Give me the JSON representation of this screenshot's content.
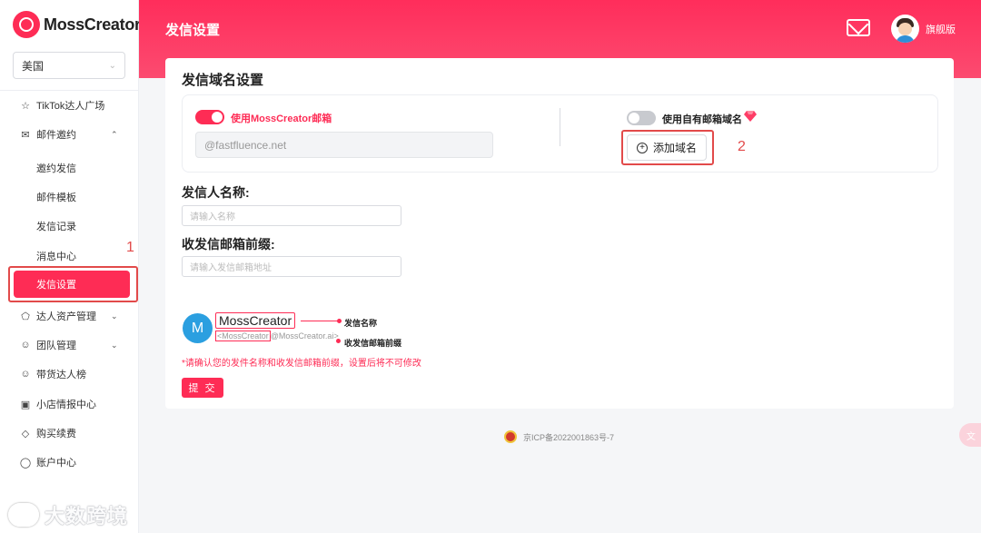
{
  "app": {
    "brand": "MossCreator"
  },
  "region": {
    "selected": "美国"
  },
  "sidebar": {
    "items": [
      {
        "label": "TikTok达人广场",
        "icon": "star-icon"
      },
      {
        "label": "邮件邀约",
        "icon": "mail-icon",
        "expanded": true
      },
      {
        "label": "达人资产管理",
        "icon": "pentagon-icon"
      },
      {
        "label": "团队管理",
        "icon": "team-icon"
      },
      {
        "label": "带货达人榜",
        "icon": "person-icon"
      },
      {
        "label": "小店情报中心",
        "icon": "shop-icon"
      },
      {
        "label": "购买续费",
        "icon": "diamond-icon"
      },
      {
        "label": "账户中心",
        "icon": "account-icon"
      }
    ],
    "subitems": [
      "邀约发信",
      "邮件模板",
      "发信记录",
      "消息中心",
      "发信设置"
    ],
    "active": "发信设置"
  },
  "header": {
    "title": "发信设置",
    "user_name": "旗舰版"
  },
  "domain_settings": {
    "title": "发信域名设置",
    "use_moss_label": "使用MossCreator邮箱",
    "use_moss_on": true,
    "domain_value": "@fastfluence.net",
    "use_own_label": "使用自有邮箱域名",
    "use_own_on": false,
    "add_domain_label": "添加域名"
  },
  "sender": {
    "name_label": "发信人名称:",
    "name_placeholder": "请输入名称",
    "prefix_label": "收发信邮箱前缀:",
    "prefix_placeholder": "请输入发信邮箱地址"
  },
  "preview": {
    "avatar_letter": "M",
    "name": "MossCreator",
    "email_prefix": "<MossCreator",
    "email_suffix": "@MossCreator.ai>",
    "name_note": "发信名称",
    "prefix_note": "收发信邮箱前缀"
  },
  "warning": "*请确认您的发件名称和收发信邮箱前缀，设置后将不可修改",
  "submit_label": "提 交",
  "footer": {
    "icp": "京ICP备2022001863号-7"
  },
  "annotations": {
    "marker1": "1",
    "marker2": "2"
  },
  "watermark": "大数跨境",
  "colors": {
    "accent": "#fe2c55",
    "annotation": "#e24a4a"
  }
}
